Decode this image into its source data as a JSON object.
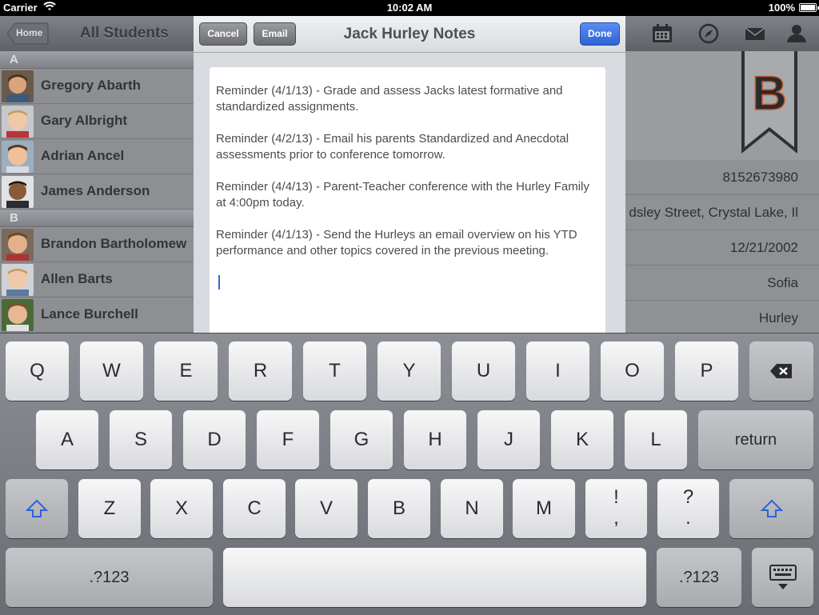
{
  "status_bar": {
    "carrier": "Carrier",
    "time": "10:02 AM",
    "battery": "100%"
  },
  "nav": {
    "home_label": "Home",
    "list_title": "All Students"
  },
  "students": {
    "sections": [
      {
        "letter": "A",
        "items": [
          {
            "name": "Gregory Abarth"
          },
          {
            "name": "Gary Albright"
          },
          {
            "name": "Adrian Ancel"
          },
          {
            "name": "James Anderson"
          }
        ]
      },
      {
        "letter": "B",
        "items": [
          {
            "name": "Brandon Bartholomew"
          },
          {
            "name": "Allen Barts"
          },
          {
            "name": "Lance Burchell"
          }
        ]
      }
    ]
  },
  "detail": {
    "grade": "B",
    "fields": [
      "8152673980",
      "dsley Street, Crystal Lake, Il",
      "12/21/2002",
      "Sofia",
      "Hurley"
    ]
  },
  "modal": {
    "title": "Jack Hurley Notes",
    "cancel": "Cancel",
    "email": "Email",
    "done": "Done",
    "notes": [
      "Reminder (4/1/13) - Grade and assess Jacks latest formative and standardized assignments.",
      "Reminder (4/2/13) - Email his parents Standardized and Anecdotal assessments prior to conference tomorrow.",
      "Reminder (4/4/13) - Parent-Teacher conference with the Hurley Family at 4:00pm today.",
      "Reminder (4/1/13) - Send the Hurleys an email overview on his YTD performance and other topics covered in the previous meeting."
    ]
  },
  "keyboard": {
    "row1": [
      "Q",
      "W",
      "E",
      "R",
      "T",
      "Y",
      "U",
      "I",
      "O",
      "P"
    ],
    "row2": [
      "A",
      "S",
      "D",
      "F",
      "G",
      "H",
      "J",
      "K",
      "L"
    ],
    "row3": [
      "Z",
      "X",
      "C",
      "V",
      "B",
      "N",
      "M"
    ],
    "return": "return",
    "punct1": [
      "!",
      ","
    ],
    "punct2": [
      "?",
      "."
    ],
    "numbers": ".?123",
    "numbers_right": ".?123"
  },
  "colors": {
    "accent_blue": "#2e62d6",
    "grade_letter": "#c85a2a"
  }
}
